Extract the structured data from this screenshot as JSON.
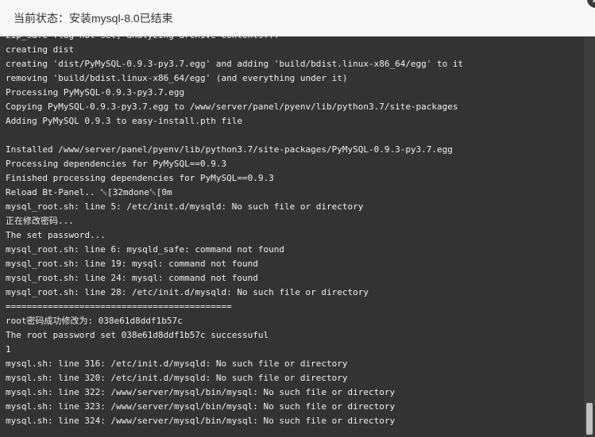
{
  "dialog": {
    "title": "当前状态：安装mysql-8.0已结束"
  },
  "icons": {
    "close": "close-icon"
  },
  "console": {
    "lines": [
      "zip_safe flag not set; analyzing archive contents...",
      "creating dist",
      "creating 'dist/PyMySQL-0.9.3-py3.7.egg' and adding 'build/bdist.linux-x86_64/egg' to it",
      "removing 'build/bdist.linux-x86_64/egg' (and everything under it)",
      "Processing PyMySQL-0.9.3-py3.7.egg",
      "Copying PyMySQL-0.9.3-py3.7.egg to /www/server/panel/pyenv/lib/python3.7/site-packages",
      "Adding PyMySQL 0.9.3 to easy-install.pth file",
      "",
      "Installed /www/server/panel/pyenv/lib/python3.7/site-packages/PyMySQL-0.9.3-py3.7.egg",
      "Processing dependencies for PyMySQL==0.9.3",
      "Finished processing dependencies for PyMySQL==0.9.3",
      "Reload Bt-Panel.. ␛[32mdone␛[0m",
      "mysql_root.sh: line 5: /etc/init.d/mysqld: No such file or directory",
      "正在修改密码...",
      "The set password...",
      "mysql_root.sh: line 6: mysqld_safe: command not found",
      "mysql_root.sh: line 19: mysql: command not found",
      "mysql_root.sh: line 24: mysql: command not found",
      "mysql_root.sh: line 28: /etc/init.d/mysqld: No such file or directory",
      "===========================================",
      "root密码成功修改为: 038e61d8ddf1b57c",
      "The root password set 038e61d8ddf1b57c successuful",
      "1",
      "mysql.sh: line 316: /etc/init.d/mysqld: No such file or directory",
      "mysql.sh: line 320: /etc/init.d/mysqld: No such file or directory",
      "mysql.sh: line 322: /www/server/mysql/bin/mysql: No such file or directory",
      "mysql.sh: line 323: /www/server/mysql/bin/mysql: No such file or directory",
      "mysql.sh: line 324: /www/server/mysql/bin/mysql: No such file or directory"
    ]
  }
}
